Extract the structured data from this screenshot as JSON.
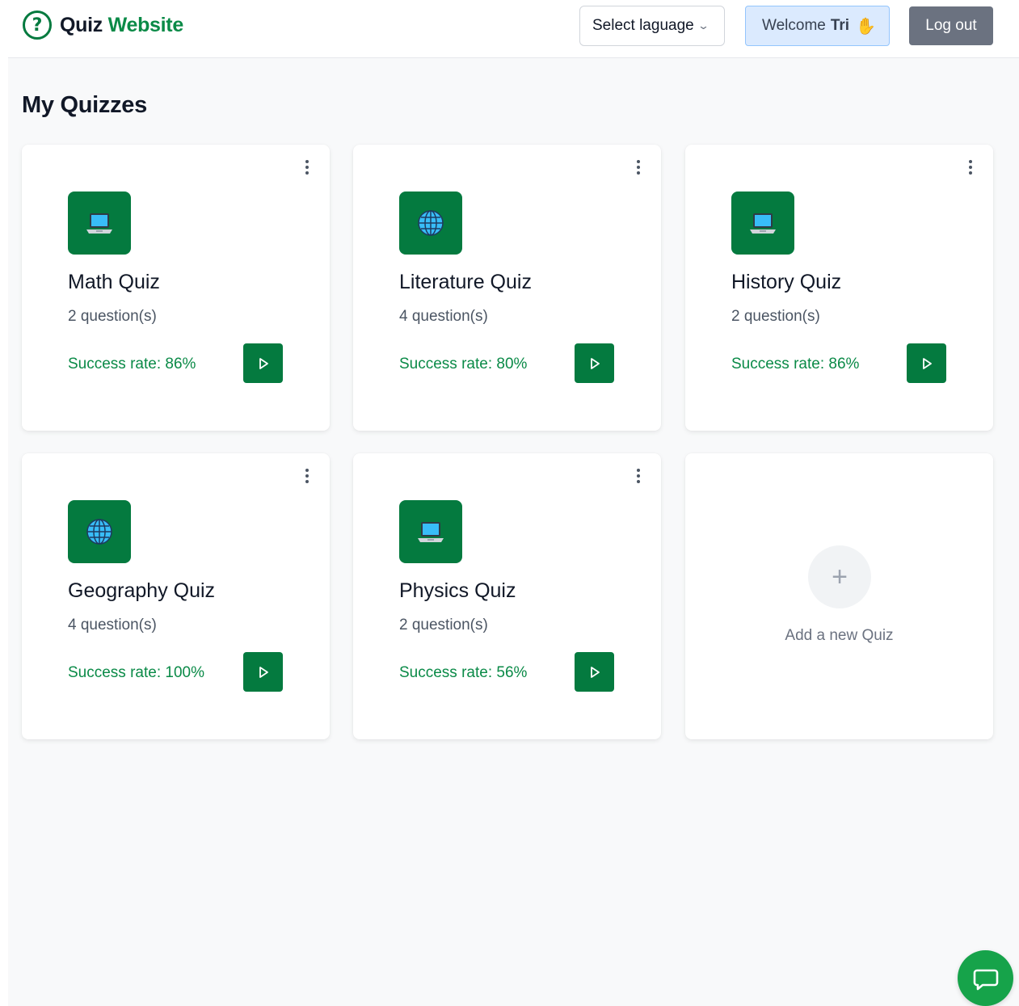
{
  "header": {
    "brand_part1": "Quiz",
    "brand_part2": "Website",
    "brand_icon": "question-circle-icon",
    "language_select": {
      "label": "Select laguage"
    },
    "welcome": {
      "prefix": "Welcome",
      "user": "Tri",
      "emoji": "✋"
    },
    "logout_label": "Log out"
  },
  "main": {
    "title": "My Quizzes",
    "quizzes": [
      {
        "title": "Math Quiz",
        "questions": "2 question(s)",
        "success_rate": "Success rate: 86%",
        "icon": "laptop-icon"
      },
      {
        "title": "Literature Quiz",
        "questions": "4 question(s)",
        "success_rate": "Success rate: 80%",
        "icon": "globe-icon"
      },
      {
        "title": "History Quiz",
        "questions": "2 question(s)",
        "success_rate": "Success rate: 86%",
        "icon": "laptop-icon"
      },
      {
        "title": "Geography Quiz",
        "questions": "4 question(s)",
        "success_rate": "Success rate: 100%",
        "icon": "globe-icon"
      },
      {
        "title": "Physics Quiz",
        "questions": "2 question(s)",
        "success_rate": "Success rate: 56%",
        "icon": "laptop-icon"
      }
    ],
    "add_quiz_label": "Add a new Quiz"
  },
  "colors": {
    "brand_green": "#047a3f",
    "success_text": "#0a8a47",
    "logout_bg": "#6b7280",
    "welcome_bg": "#dbeafe",
    "chat_button": "#16a34a"
  }
}
